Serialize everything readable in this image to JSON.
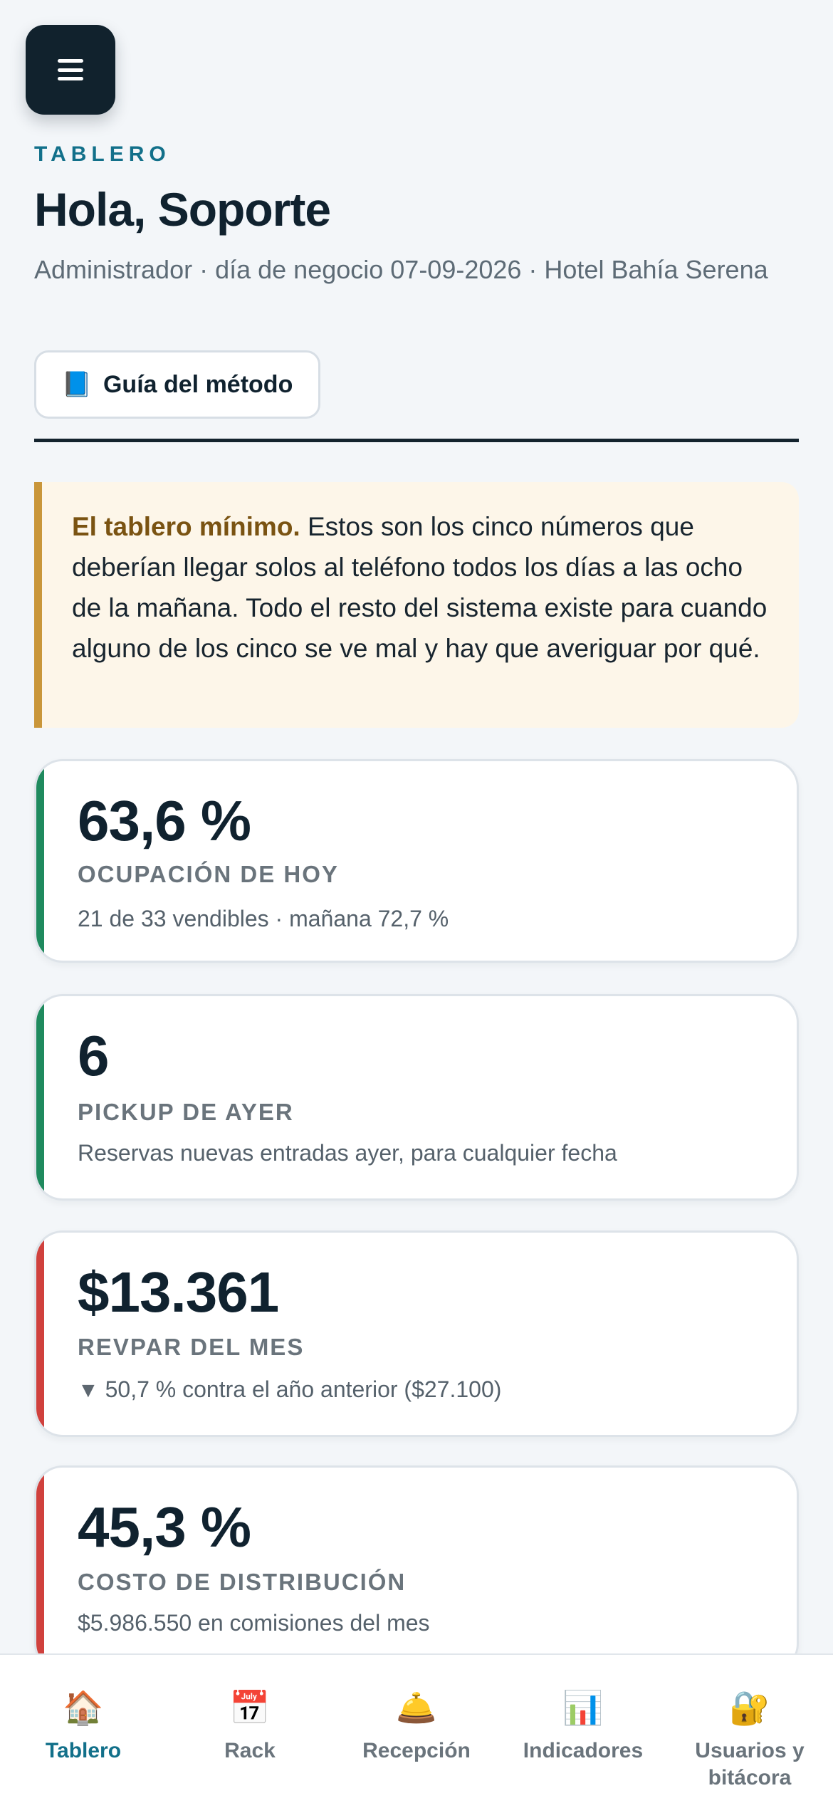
{
  "menu": {
    "icon": "hamburger-menu-icon"
  },
  "header": {
    "eyebrow": "TABLERO",
    "greeting": "Hola, Soporte",
    "subtitle": "Administrador · día de negocio 07-09-2026 · Hotel Bahía Serena",
    "guide_icon": "📘",
    "guide_label": "Guía del método"
  },
  "note": {
    "lead": "El tablero mínimo.",
    "body": " Estos son los cinco números que deberían llegar solos al teléfono todos los días a las ocho de la mañana. Todo el resto del sistema existe para cuando alguno de los cinco se ve mal y hay que averiguar por qué.",
    "accent_color": "#c9963a"
  },
  "cards": [
    {
      "value": "63,6 %",
      "label": "OCUPACIÓN DE HOY",
      "detail": "21 de 33 vendibles · mañana 72,7 %",
      "status": "good",
      "color": "#1f8a5e"
    },
    {
      "value": "6",
      "label": "PICKUP DE AYER",
      "detail": "Reservas nuevas entradas ayer, para cualquier fecha",
      "status": "good",
      "color": "#1f8a5e"
    },
    {
      "value": "$13.361",
      "label": "REVPAR DEL MES",
      "trend_icon": "▼",
      "detail": "50,7 % contra el año anterior ($27.100)",
      "status": "bad",
      "color": "#d0413d"
    },
    {
      "value": "45,3 %",
      "label": "COSTO DE DISTRIBUCIÓN",
      "detail": "$5.986.550 en comisiones del mes",
      "status": "bad",
      "color": "#d0413d"
    }
  ],
  "nav": [
    {
      "label": "Tablero",
      "icon": "🏠",
      "icon_name": "house-icon",
      "active": true
    },
    {
      "label": "Rack",
      "icon": "📅",
      "icon_name": "calendar-icon",
      "active": false
    },
    {
      "label": "Recepción",
      "icon": "🛎️",
      "icon_name": "bell-icon",
      "active": false
    },
    {
      "label": "Indicadores",
      "icon": "📊",
      "icon_name": "bar-chart-icon",
      "active": false
    },
    {
      "label": "Usuarios y bitácora",
      "icon": "🔐",
      "icon_name": "lock-icon",
      "active": false
    }
  ],
  "colors": {
    "accent": "#12708a",
    "dark": "#11222d",
    "good": "#1f8a5e",
    "bad": "#d0413d"
  }
}
